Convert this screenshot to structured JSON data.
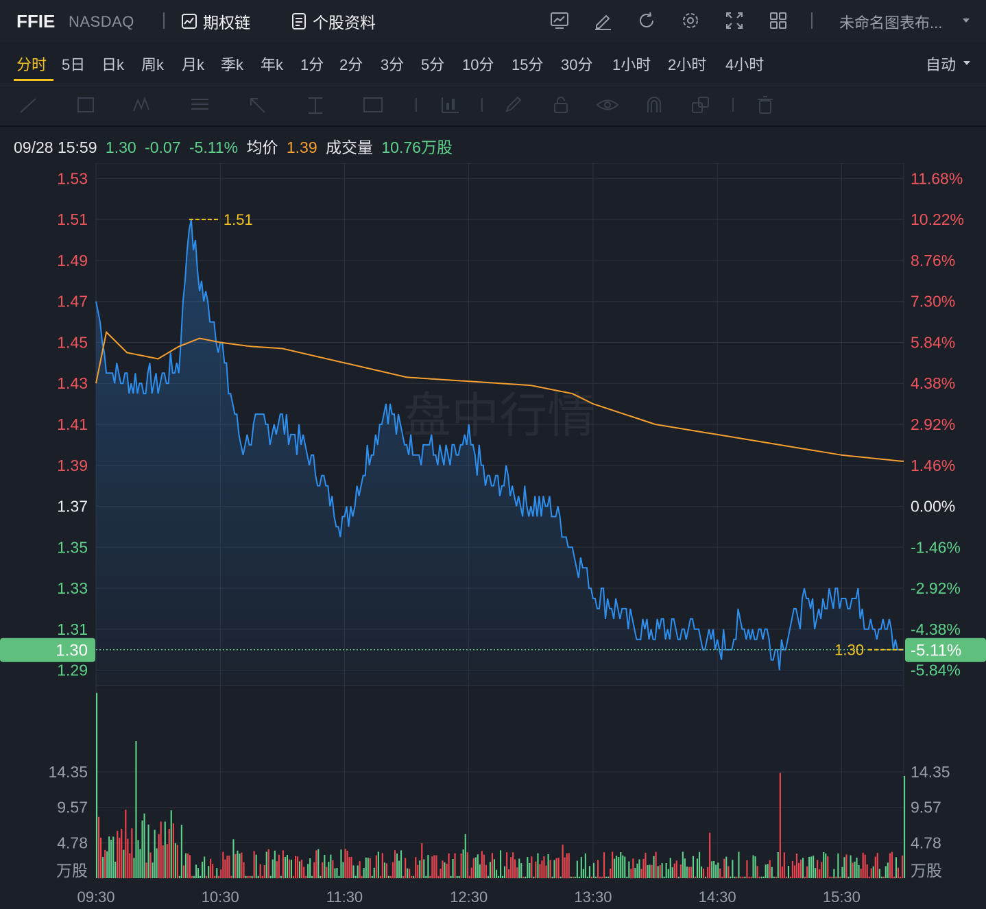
{
  "header": {
    "symbol": "FFIE",
    "exchange": "NASDAQ",
    "options_chain_label": "期权链",
    "profile_label": "个股资料",
    "layout_name": "未命名图表布...",
    "icons": [
      "chart-template-icon",
      "edit-icon",
      "refresh-icon",
      "settings-icon",
      "fullscreen-icon",
      "grid-layout-icon"
    ]
  },
  "periods": {
    "items": [
      "分时",
      "5日",
      "日k",
      "周k",
      "月k",
      "季k",
      "年k",
      "1分",
      "2分",
      "3分",
      "5分",
      "10分",
      "15分",
      "30分",
      "1小时",
      "2小时",
      "4小时"
    ],
    "active": "分时",
    "auto_label": "自动"
  },
  "info": {
    "datetime": "09/28 15:59",
    "price": "1.30",
    "change": "-0.07",
    "change_pct": "-5.11%",
    "avg_label": "均价",
    "avg_value": "1.39",
    "volume_label": "成交量",
    "volume_value": "10.76万股"
  },
  "colors": {
    "up": "#f0454e",
    "down": "#5fd28a",
    "price_line": "#2e8fef",
    "avg_line": "#f7a030",
    "highlight": "#f5c320",
    "accent_label_bg": "#5fbf7d"
  },
  "chart_data": {
    "type": "line",
    "title": "",
    "x_ticks": [
      "09:30",
      "10:30",
      "11:30",
      "12:30",
      "13:30",
      "14:30",
      "15:30"
    ],
    "price_axis_ticks": [
      "1.53",
      "1.51",
      "1.49",
      "1.47",
      "1.45",
      "1.43",
      "1.41",
      "1.39",
      "1.37",
      "1.35",
      "1.33",
      "1.31",
      "1.29"
    ],
    "pct_axis_ticks": [
      "11.68%",
      "10.22%",
      "8.76%",
      "7.30%",
      "5.84%",
      "4.38%",
      "2.92%",
      "1.46%",
      "0.00%",
      "-1.46%",
      "-2.92%",
      "-4.38%",
      "-5.84%"
    ],
    "prev_close": 1.37,
    "ylim": [
      1.2825,
      1.5375
    ],
    "high_marker": "1.51",
    "last_marker": "1.30",
    "last_price_label": "1.30",
    "last_pct_label": "-5.11%",
    "watermark": "盘中行情",
    "series": [
      {
        "name": "",
        "x": [
          "09:30",
          "09:35",
          "09:45",
          "10:00",
          "10:10",
          "10:15",
          "10:20",
          "10:30",
          "10:40",
          "10:50",
          "11:00",
          "11:10",
          "11:20",
          "11:30",
          "11:40",
          "11:50",
          "12:00",
          "12:10",
          "12:20",
          "12:30",
          "12:40",
          "12:50",
          "13:00",
          "13:10",
          "13:20",
          "13:30",
          "13:40",
          "13:50",
          "14:00",
          "14:10",
          "14:20",
          "14:30",
          "14:40",
          "14:50",
          "15:00",
          "15:10",
          "15:20",
          "15:30",
          "15:40",
          "15:50",
          "15:59"
        ],
        "values": [
          1.47,
          1.44,
          1.43,
          1.43,
          1.44,
          1.51,
          1.48,
          1.45,
          1.4,
          1.41,
          1.41,
          1.4,
          1.38,
          1.36,
          1.39,
          1.42,
          1.4,
          1.4,
          1.39,
          1.4,
          1.38,
          1.38,
          1.37,
          1.37,
          1.35,
          1.33,
          1.32,
          1.31,
          1.31,
          1.31,
          1.31,
          1.3,
          1.31,
          1.31,
          1.3,
          1.32,
          1.32,
          1.33,
          1.32,
          1.31,
          1.3
        ]
      },
      {
        "name": "",
        "x": [
          "09:30",
          "09:35",
          "09:45",
          "10:00",
          "10:10",
          "10:20",
          "10:30",
          "10:45",
          "11:00",
          "11:30",
          "12:00",
          "12:30",
          "13:00",
          "13:20",
          "13:30",
          "13:45",
          "14:00",
          "14:30",
          "15:00",
          "15:30",
          "15:59"
        ],
        "values": [
          1.43,
          1.455,
          1.445,
          1.442,
          1.448,
          1.452,
          1.45,
          1.448,
          1.447,
          1.44,
          1.433,
          1.431,
          1.429,
          1.425,
          1.42,
          1.415,
          1.41,
          1.405,
          1.4,
          1.395,
          1.392
        ]
      }
    ],
    "volume": {
      "unit_label": "万股",
      "axis_ticks": [
        "14.35",
        "9.57",
        "4.78"
      ],
      "ylim": [
        0,
        26
      ]
    }
  }
}
